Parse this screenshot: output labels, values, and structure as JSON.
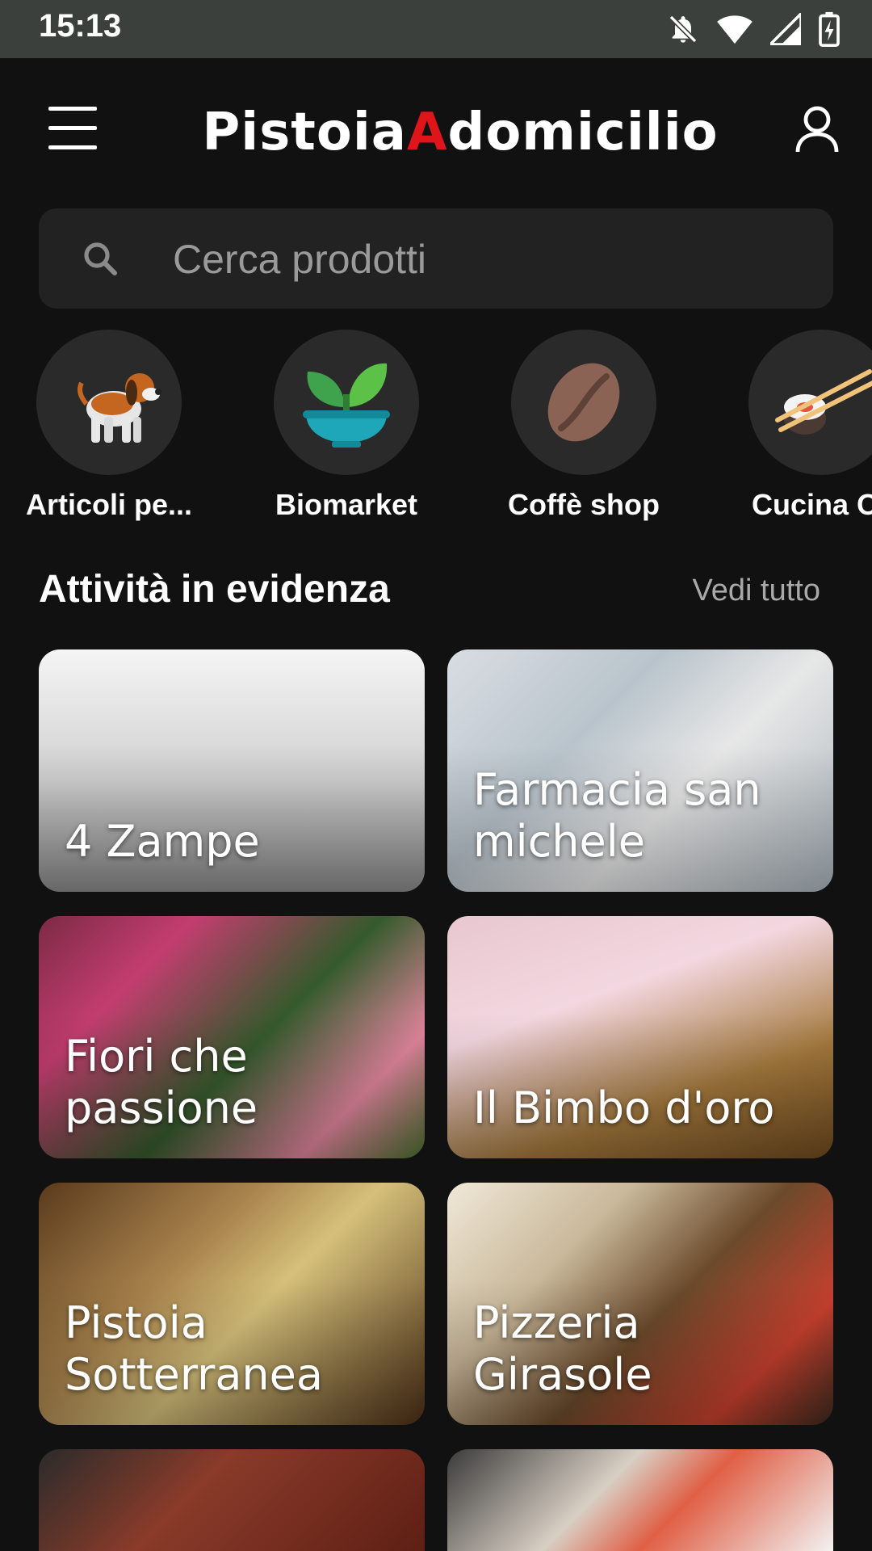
{
  "status_bar": {
    "time": "15:13",
    "icons": [
      "notifications-off-icon",
      "wifi-icon",
      "signal-icon",
      "battery-charging-icon"
    ]
  },
  "app_bar": {
    "logo_part1": "Pistoia",
    "logo_part2": "A",
    "logo_part3": "domicilio",
    "menu_icon": "hamburger-menu-icon",
    "profile_icon": "user-profile-icon",
    "colors": {
      "logo_white": "#ffffff",
      "logo_accent": "#e0141b"
    }
  },
  "search": {
    "placeholder": "Cerca prodotti",
    "icon": "search-icon"
  },
  "categories": [
    {
      "label": "Articoli pe...",
      "icon": "dog-icon"
    },
    {
      "label": "Biomarket",
      "icon": "plant-bowl-icon"
    },
    {
      "label": "Coffè shop",
      "icon": "coffee-bean-icon"
    },
    {
      "label": "Cucina Or",
      "icon": "sushi-chopsticks-icon"
    }
  ],
  "featured": {
    "title": "Attività in evidenza",
    "see_all": "Vedi tutto",
    "cards": [
      {
        "label": "4 Zampe"
      },
      {
        "label": "Farmacia san michele"
      },
      {
        "label": "Fiori che passione"
      },
      {
        "label": "Il Bimbo d'oro"
      },
      {
        "label": "Pistoia Sotterranea"
      },
      {
        "label": "Pizzeria Girasole"
      },
      {
        "label": ""
      },
      {
        "label": ""
      }
    ]
  },
  "theme": {
    "background": "#111111",
    "status_bar": "#3b403c",
    "surface": "#222222"
  }
}
